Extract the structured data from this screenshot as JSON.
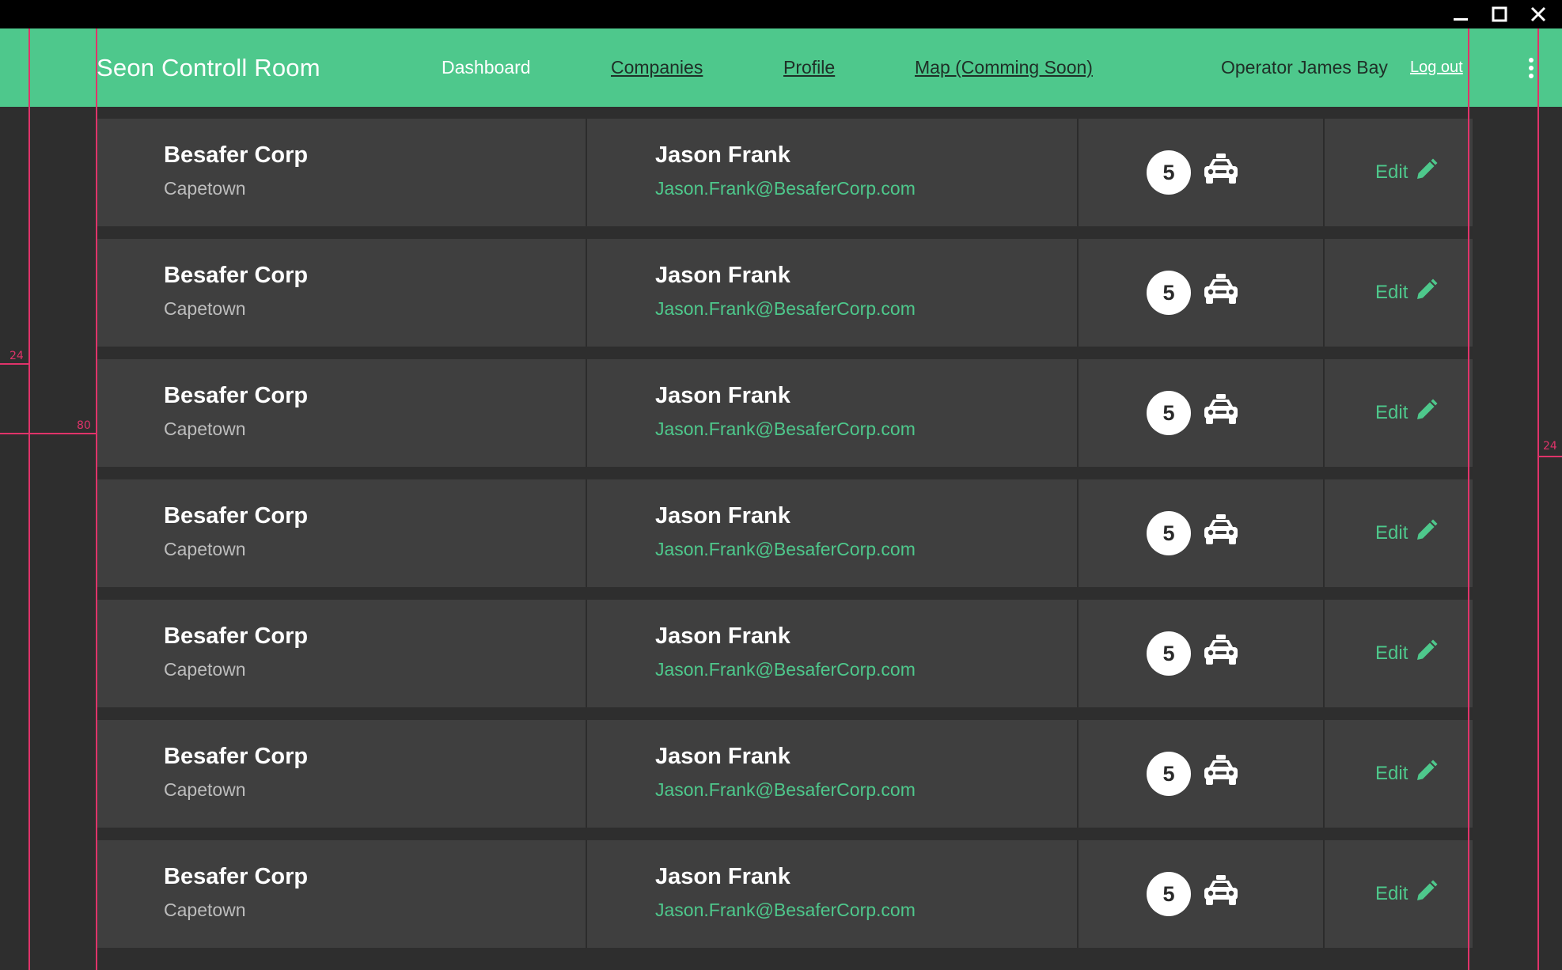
{
  "window": {
    "controls": [
      "minimize-icon",
      "maximize-icon",
      "close-icon"
    ]
  },
  "header": {
    "brand": "Seon Controll Room",
    "nav": [
      {
        "label": "Dashboard"
      },
      {
        "label": "Companies"
      },
      {
        "label": "Profile"
      },
      {
        "label": "Map (Comming Soon)"
      }
    ],
    "operator": "Operator James Bay",
    "logout": "Log out"
  },
  "guides": {
    "left_margin": "24",
    "content_margin": "80",
    "right_margin": "24"
  },
  "colors": {
    "accent": "#4ec88c",
    "background": "#2e2e2e",
    "row": "#3f3f3f",
    "guide": "#e0336a"
  },
  "rows": [
    {
      "company": "Besafer Corp",
      "city": "Capetown",
      "contact": "Jason Frank",
      "email": "Jason.Frank@BesaferCorp.com",
      "count": "5",
      "edit": "Edit"
    },
    {
      "company": "Besafer Corp",
      "city": "Capetown",
      "contact": "Jason Frank",
      "email": "Jason.Frank@BesaferCorp.com",
      "count": "5",
      "edit": "Edit"
    },
    {
      "company": "Besafer Corp",
      "city": "Capetown",
      "contact": "Jason Frank",
      "email": "Jason.Frank@BesaferCorp.com",
      "count": "5",
      "edit": "Edit"
    },
    {
      "company": "Besafer Corp",
      "city": "Capetown",
      "contact": "Jason Frank",
      "email": "Jason.Frank@BesaferCorp.com",
      "count": "5",
      "edit": "Edit"
    },
    {
      "company": "Besafer Corp",
      "city": "Capetown",
      "contact": "Jason Frank",
      "email": "Jason.Frank@BesaferCorp.com",
      "count": "5",
      "edit": "Edit"
    },
    {
      "company": "Besafer Corp",
      "city": "Capetown",
      "contact": "Jason Frank",
      "email": "Jason.Frank@BesaferCorp.com",
      "count": "5",
      "edit": "Edit"
    },
    {
      "company": "Besafer Corp",
      "city": "Capetown",
      "contact": "Jason Frank",
      "email": "Jason.Frank@BesaferCorp.com",
      "count": "5",
      "edit": "Edit"
    }
  ]
}
